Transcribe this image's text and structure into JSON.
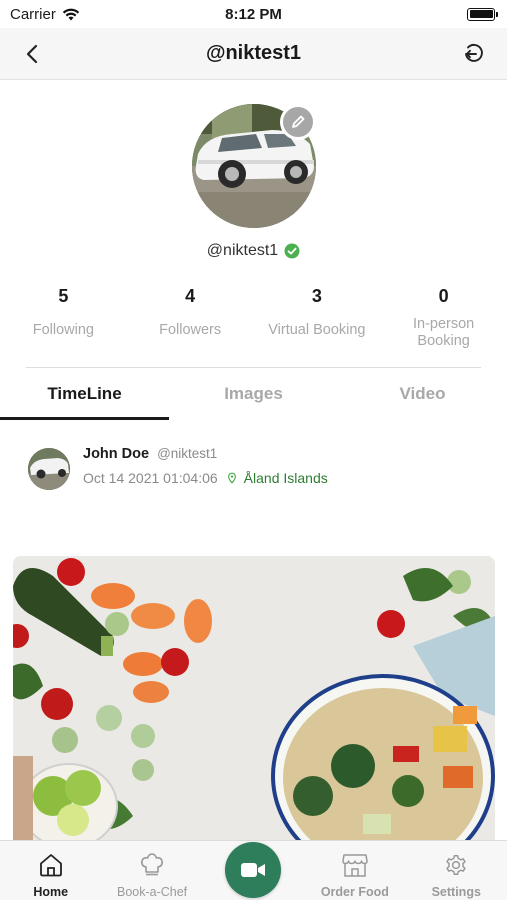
{
  "status_bar": {
    "carrier": "Carrier",
    "time": "8:12 PM"
  },
  "header": {
    "title": "@niktest1"
  },
  "profile": {
    "handle": "@niktest1",
    "verified": true
  },
  "stats": [
    {
      "value": "5",
      "label": "Following"
    },
    {
      "value": "4",
      "label": "Followers"
    },
    {
      "value": "3",
      "label": "Virtual Booking"
    },
    {
      "value": "0",
      "label": "In-person Booking"
    }
  ],
  "tabs": [
    {
      "label": "TimeLine",
      "active": true
    },
    {
      "label": "Images",
      "active": false
    },
    {
      "label": "Video",
      "active": false
    }
  ],
  "post": {
    "author_name": "John Doe",
    "author_username": "@niktest1",
    "timestamp": "Oct 14 2021 01:04:06",
    "location": "Åland Islands"
  },
  "tabbar": [
    {
      "label": "Home",
      "icon": "home-icon",
      "active": true
    },
    {
      "label": "Book-a-Chef",
      "icon": "chef-hat-icon",
      "active": false
    },
    {
      "label": "",
      "icon": "video-camera-icon",
      "active": false
    },
    {
      "label": "Order Food",
      "icon": "store-icon",
      "active": false
    },
    {
      "label": "Settings",
      "icon": "gear-icon",
      "active": false
    }
  ],
  "colors": {
    "accent_green": "#2e7d5b",
    "location_green": "#2e7d32",
    "verified_green": "#4caf50"
  }
}
